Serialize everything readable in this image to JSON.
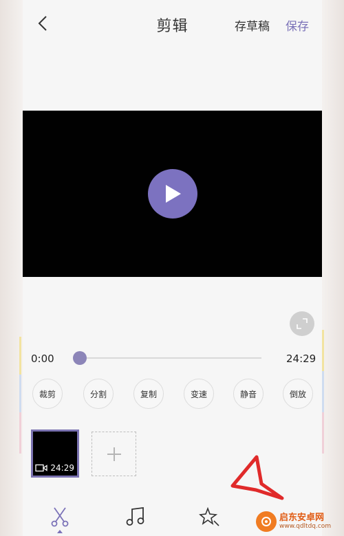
{
  "header": {
    "title": "剪辑",
    "draft_label": "存草稿",
    "save_label": "保存"
  },
  "player": {
    "current_time": "0:00",
    "total_time": "24:29",
    "progress": 0.0
  },
  "tools": [
    {
      "label": "裁剪"
    },
    {
      "label": "分割"
    },
    {
      "label": "复制"
    },
    {
      "label": "变速"
    },
    {
      "label": "静音"
    },
    {
      "label": "倒放"
    }
  ],
  "clips": [
    {
      "duration": "24:29"
    }
  ],
  "bottom_nav": {
    "items": [
      {
        "icon": "scissors-icon"
      },
      {
        "icon": "music-note-icon"
      },
      {
        "icon": "sparkle-wand-icon"
      }
    ]
  },
  "watermark": {
    "name": "启东安卓网",
    "url": "www.qdltdq.com"
  },
  "colors": {
    "accent": "#7b72b8",
    "play_button": "#7c72c0",
    "video_bg": "#010101",
    "annotation": "#e02a2a",
    "watermark": "#e05a12"
  }
}
